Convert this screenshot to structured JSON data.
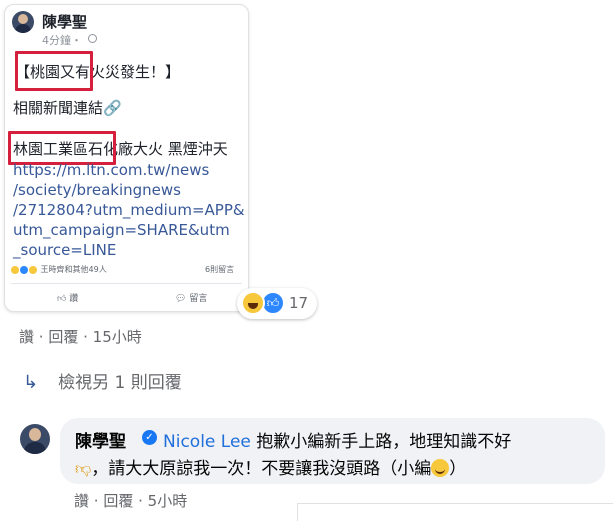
{
  "screenshot_card": {
    "author": "陳學聖",
    "time": "4分鐘・",
    "line1": "【桃園又有火災發生！】",
    "line2": "相關新聞連結🔗",
    "line3": "林園工業區石化廠大火 黑煙沖天",
    "url": "https://m.ltn.com.tw/news\n/society/breakingnews\n/2712804?utm_medium=APP&\nutm_campaign=SHARE&utm\n_source=LINE",
    "reactions_text": "王時齊和其他49人",
    "comments_text": "6則留言",
    "like_label": "讚",
    "comment_label": "留言"
  },
  "reaction_count": "17",
  "comment_actions": {
    "like": "讚",
    "sep1": " · ",
    "reply": "回覆",
    "sep2": " · ",
    "time": "15小時"
  },
  "view_more_replies": "檢視另 1 則回覆",
  "reply": {
    "author": "陳學聖",
    "mention": "Nicole Lee",
    "text_line1": " 抱歉小編新手上路，地理知識不好",
    "text_line2_pre": "，請大大原諒我一次！不要讓我沒頭路（小編",
    "text_line2_post": "）",
    "actions": {
      "like": "讚",
      "sep1": " · ",
      "reply": "回覆",
      "sep2": " · ",
      "time": "5小時"
    }
  },
  "colors": {
    "link": "#385898",
    "mention": "#216fdb",
    "highlight_box": "#d5203d",
    "bubble_bg": "#f0f2f5"
  }
}
